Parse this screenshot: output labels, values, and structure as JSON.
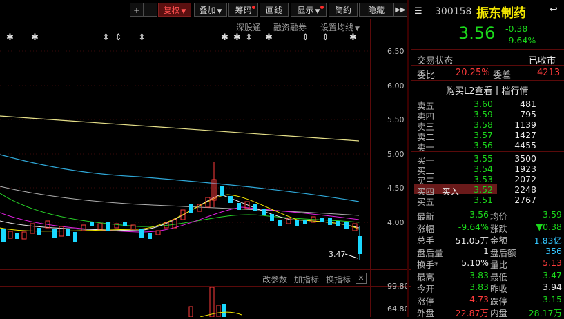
{
  "toolbar": {
    "plus": "+",
    "minus": "一",
    "fuquan": "复权",
    "diejia": "叠加",
    "chouma": "筹码",
    "huaxian": "画线",
    "xianshi": "显示",
    "jianyue": "简约",
    "pingcang": "隐藏",
    "expand": "▶▶"
  },
  "chart_sublinks": {
    "shengutong": "深股通",
    "rongzi": "融资融券",
    "setting": "设置均线"
  },
  "chart_data": {
    "type": "candlestick",
    "y_axis_ticks": [
      "6.50",
      "6.00",
      "5.50",
      "5.00",
      "4.50",
      "4.00"
    ],
    "low_marker": "3.47",
    "lower_axis_ticks": [
      "99.80",
      "64.80"
    ],
    "lower_links": [
      "改参数",
      "加指标",
      "换指标"
    ],
    "colors": {
      "up": "#ff3b3b",
      "down": "#1ad8ff",
      "ma_yellow": "#e6e08a",
      "ma_blue": "#2fa8d8",
      "ma_gray": "#b0b0b0",
      "ma_green": "#27d027",
      "ma_magenta": "#e020e0"
    }
  },
  "panel": {
    "code": "300158",
    "name": "振东制药",
    "price": "3.56",
    "change": "-0.38",
    "change_pct": "-9.64%",
    "status_label": "交易状态",
    "status_value": "已收市",
    "weibi_label": "委比",
    "weibi_value": "20.25%",
    "weicha_label": "委差",
    "weicha_value": "4213",
    "l2_link": "购买L2查看十档行情",
    "asks": [
      {
        "label": "卖五",
        "price": "3.60",
        "vol": "481"
      },
      {
        "label": "卖四",
        "price": "3.59",
        "vol": "795"
      },
      {
        "label": "卖三",
        "price": "3.58",
        "vol": "1139"
      },
      {
        "label": "卖二",
        "price": "3.57",
        "vol": "1427"
      },
      {
        "label": "卖一",
        "price": "3.56",
        "vol": "4455"
      }
    ],
    "bids": [
      {
        "label": "买一",
        "price": "3.55",
        "vol": "3500"
      },
      {
        "label": "买二",
        "price": "3.54",
        "vol": "1923"
      },
      {
        "label": "买三",
        "price": "3.53",
        "vol": "2072"
      },
      {
        "label": "买四",
        "price": "3.52",
        "vol": "2248"
      },
      {
        "label": "买五",
        "price": "3.51",
        "vol": "2767"
      }
    ],
    "buy_button": "买入",
    "stats": [
      {
        "k1": "最新",
        "v1": "3.56",
        "c1": "green",
        "k2": "均价",
        "v2": "3.59",
        "c2": "green"
      },
      {
        "k1": "涨幅",
        "v1": "-9.64%",
        "c1": "green",
        "k2": "涨跌",
        "v2": "▼0.38",
        "c2": "green"
      },
      {
        "k1": "总手",
        "v1": "51.05万",
        "c1": "white",
        "k2": "金额",
        "v2": "1.83亿",
        "c2": "cyan"
      },
      {
        "k1": "盘后量",
        "v1": "1",
        "c1": "white",
        "k2": "盘后额",
        "v2": "356",
        "c2": "cyan"
      },
      {
        "k1": "换手*",
        "v1": "5.10%",
        "c1": "white",
        "k2": "量比",
        "v2": "5.13",
        "c2": "red"
      },
      {
        "k1": "最高",
        "v1": "3.83",
        "c1": "green",
        "k2": "最低",
        "v2": "3.47",
        "c2": "green"
      },
      {
        "k1": "今开",
        "v1": "3.83",
        "c1": "green",
        "k2": "昨收",
        "v2": "3.94",
        "c2": "white"
      },
      {
        "k1": "涨停",
        "v1": "4.73",
        "c1": "red",
        "k2": "跌停",
        "v2": "3.15",
        "c2": "green"
      },
      {
        "k1": "外盘",
        "v1": "22.87万",
        "c1": "red",
        "k2": "内盘",
        "v2": "28.17万",
        "c2": "green"
      }
    ]
  }
}
